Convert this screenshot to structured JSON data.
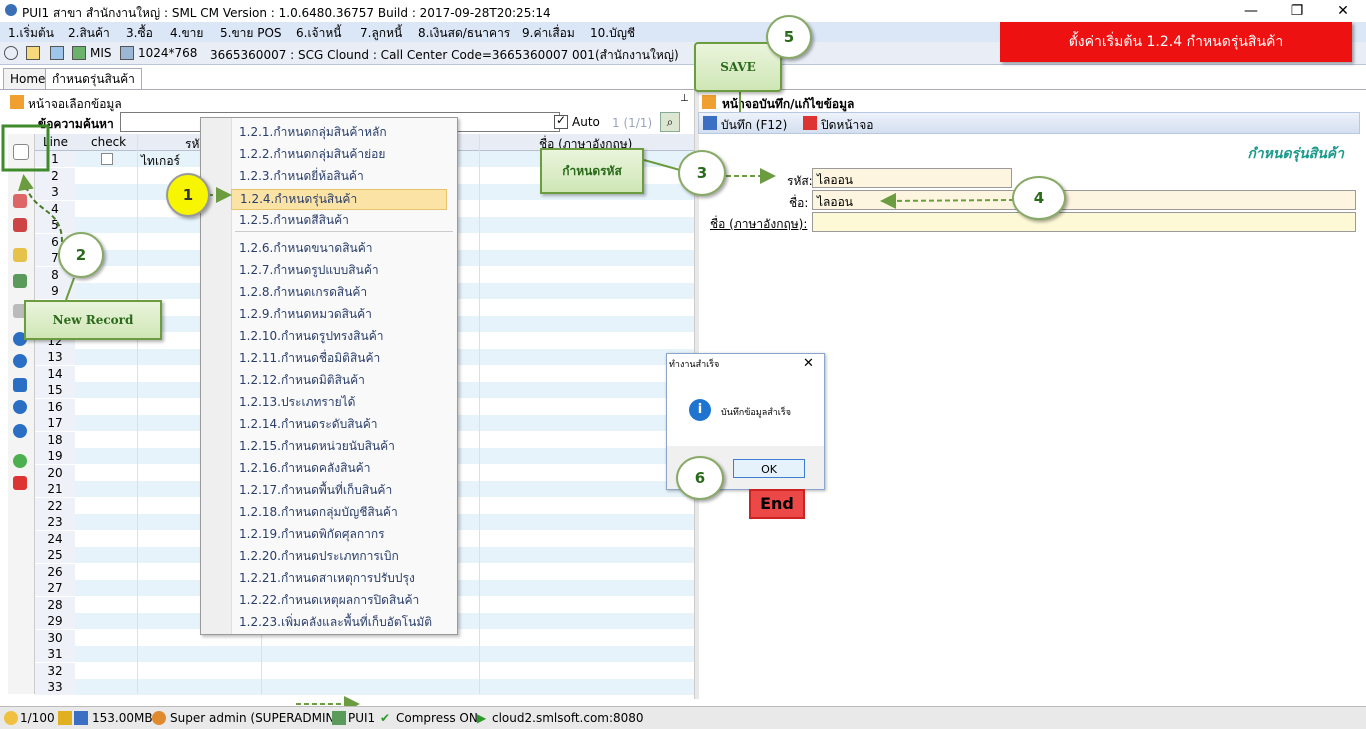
{
  "window": {
    "title": "PUI1 สาขา สำนักงานใหญ่ : SML CM Version : 1.0.6480.36757  Build : 2017-09-28T20:25:14",
    "minimize": "—",
    "restore": "❐",
    "close": "✕"
  },
  "menu": [
    "1.เริ่มต้น",
    "2.สินค้า",
    "3.ซื้อ",
    "4.ขาย",
    "5.ขาย POS",
    "6.เจ้าหนี้",
    "7.ลูกหนี้",
    "8.เงินสด/ธนาคาร",
    "9.ค่าเสื่อม",
    "10.บัญชี"
  ],
  "toolbar": {
    "mis": "MIS",
    "resolution": "1024*768",
    "info": "3665360007 : SCG Clound : Call Center Code=3665360007 001(สำนักงานใหญ่)"
  },
  "tabs": [
    "Home",
    "กำหนดรุ่นสินค้า"
  ],
  "left_panel": {
    "title": "หน้าจอเลือกข้อมูล",
    "search_label": "ข้อความค้นหา",
    "auto_label": "Auto",
    "page_info": "1 (1/1)",
    "columns": [
      "Line",
      "check",
      "รหัส",
      "ชื่อ (ภาษาอังกฤษ)"
    ],
    "first_row_name": "ไทเกอร์",
    "row_numbers": [
      "1",
      "2",
      "3",
      "4",
      "5",
      "6",
      "7",
      "8",
      "9",
      "10",
      "11",
      "12",
      "13",
      "14",
      "15",
      "16",
      "17",
      "18",
      "19",
      "20",
      "21",
      "22",
      "23",
      "24",
      "25",
      "26",
      "27",
      "28",
      "29",
      "30",
      "31",
      "32",
      "33"
    ]
  },
  "dropdown": {
    "items": [
      "1.2.1.กำหนดกลุ่มสินค้าหลัก",
      "1.2.2.กำหนดกลุ่มสินค้าย่อย",
      "1.2.3.กำหนดยี่ห้อสินค้า",
      "1.2.4.กำหนดรุ่นสินค้า",
      "1.2.5.กำหนดสีสินค้า",
      "1.2.6.กำหนดขนาดสินค้า",
      "1.2.7.กำหนดรูปแบบสินค้า",
      "1.2.8.กำหนดเกรดสินค้า",
      "1.2.9.กำหนดหมวดสินค้า",
      "1.2.10.กำหนดรูปทรงสินค้า",
      "1.2.11.กำหนดชื่อมิติสินค้า",
      "1.2.12.กำหนดมิติสินค้า",
      "1.2.13.ประเภทรายได้",
      "1.2.14.กำหนดระดับสินค้า",
      "1.2.15.กำหนดหน่วยนับสินค้า",
      "1.2.16.กำหนดคลังสินค้า",
      "1.2.17.กำหนดพื้นที่เก็บสินค้า",
      "1.2.18.กำหนดกลุ่มบัญชีสินค้า",
      "1.2.19.กำหนดพิกัดศุลกากร",
      "1.2.20.กำหนดประเภทการเบิก",
      "1.2.21.กำหนดสาเหตุการปรับปรุง",
      "1.2.22.กำหนดเหตุผลการปิดสินค้า",
      "1.2.23.เพิ่มคลังและพื้นที่เก็บอัตโนมัติ"
    ],
    "highlighted_index": 3
  },
  "right_panel": {
    "title": "หน้าจอบันทึก/แก้ไขข้อมูล",
    "save_button": "บันทึก (F12)",
    "close_button": "ปิดหน้าจอ",
    "form_title": "กำหนดรุ่นสินค้า",
    "code_label": "รหัส:",
    "code_value": "ไลออน",
    "name_label": "ชื่อ:",
    "name_value": "ไลออน",
    "name_en_label": "ชื่อ (ภาษาอังกฤษ):",
    "name_en_value": ""
  },
  "dialog": {
    "title": "ทำงานสำเร็จ",
    "message": "บันทึกข้อมูลสำเร็จ",
    "ok": "OK"
  },
  "end_button": "End",
  "banner": "ตั้งค่าเริ่มต้น 1.2.4 กำหนดรุ่นสินค้า",
  "annotations": {
    "step1": "1",
    "step2": "2",
    "step3": "3",
    "step4": "4",
    "step5": "5",
    "step6": "6",
    "save_callout": "SAVE",
    "new_record_callout": "New Record",
    "code_callout": "กำหนดรหัส"
  },
  "statusbar": {
    "page": "1/100",
    "memory": "153.00MB",
    "user": "Super admin (SUPERADMIN)",
    "branch": "PUI1",
    "compress": "Compress ON",
    "server": "cloud2.smlsoft.com:8080"
  },
  "colors": {
    "banner": "#ee1111",
    "menu_highlight": "#fbe3a6",
    "callout_green": "#6c9c40",
    "step1_yellow": "#f7f600"
  }
}
